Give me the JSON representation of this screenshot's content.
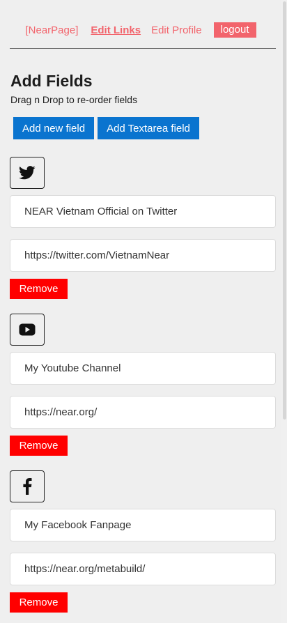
{
  "nav": {
    "brand": "[NearPage]",
    "edit_links": "Edit Links",
    "edit_profile": "Edit Profile",
    "logout": "logout"
  },
  "header": {
    "title": "Add Fields",
    "subtitle": "Drag n Drop to re-order fields"
  },
  "buttons": {
    "add_field": "Add new field",
    "add_textarea": "Add Textarea field"
  },
  "fields": [
    {
      "icon": "twitter-icon",
      "title": "NEAR Vietnam Official on Twitter",
      "url": "https://twitter.com/VietnamNear",
      "remove": "Remove"
    },
    {
      "icon": "youtube-icon",
      "title": "My Youtube Channel",
      "url": "https://near.org/",
      "remove": "Remove"
    },
    {
      "icon": "facebook-icon",
      "title": "My Facebook Fanpage",
      "url": "https://near.org/metabuild/",
      "remove": "Remove"
    }
  ],
  "colors": {
    "accent": "#f2646c",
    "primary_button": "#0a74cf",
    "remove_button": "#ff0000",
    "background": "#efefef"
  }
}
